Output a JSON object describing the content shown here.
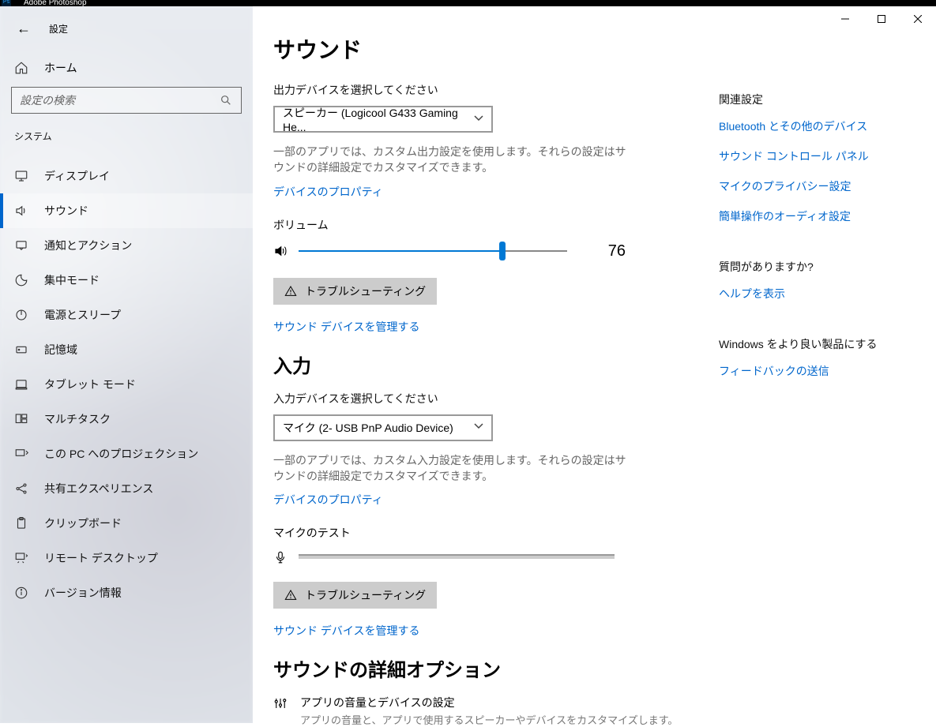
{
  "taskbar_app": "Adobe Photoshop",
  "header": {
    "back_icon": "←",
    "title": "設定"
  },
  "home_label": "ホーム",
  "search": {
    "placeholder": "設定の検索"
  },
  "category": "システム",
  "nav": [
    {
      "id": "display",
      "label": "ディスプレイ"
    },
    {
      "id": "sound",
      "label": "サウンド"
    },
    {
      "id": "notifications",
      "label": "通知とアクション"
    },
    {
      "id": "focus",
      "label": "集中モード"
    },
    {
      "id": "power",
      "label": "電源とスリープ"
    },
    {
      "id": "storage",
      "label": "記憶域"
    },
    {
      "id": "tablet",
      "label": "タブレット モード"
    },
    {
      "id": "multitask",
      "label": "マルチタスク"
    },
    {
      "id": "projection",
      "label": "この PC へのプロジェクション"
    },
    {
      "id": "shared",
      "label": "共有エクスペリエンス"
    },
    {
      "id": "clipboard",
      "label": "クリップボード"
    },
    {
      "id": "remote",
      "label": "リモート デスクトップ"
    },
    {
      "id": "about",
      "label": "バージョン情報"
    }
  ],
  "main": {
    "title": "サウンド",
    "output": {
      "label": "出力デバイスを選択してください",
      "selected": "スピーカー (Logicool G433 Gaming He...",
      "desc": "一部のアプリでは、カスタム出力設定を使用します。それらの設定はサウンドの詳細設定でカスタマイズできます。",
      "properties_link": "デバイスのプロパティ",
      "volume_label": "ボリューム",
      "volume_value": "76",
      "troubleshoot": "トラブルシューティング",
      "manage_link": "サウンド デバイスを管理する"
    },
    "input": {
      "title": "入力",
      "label": "入力デバイスを選択してください",
      "selected": "マイク (2- USB PnP Audio Device)",
      "desc": "一部のアプリでは、カスタム入力設定を使用します。それらの設定はサウンドの詳細設定でカスタマイズできます。",
      "properties_link": "デバイスのプロパティ",
      "test_label": "マイクのテスト",
      "troubleshoot": "トラブルシューティング",
      "manage_link": "サウンド デバイスを管理する"
    },
    "advanced": {
      "title": "サウンドの詳細オプション",
      "row_title": "アプリの音量とデバイスの設定",
      "row_desc": "アプリの音量と、アプリで使用するスピーカーやデバイスをカスタマイズします。"
    }
  },
  "right": {
    "related_heading": "関連設定",
    "related_links": [
      "Bluetooth とその他のデバイス",
      "サウンド コントロール パネル",
      "マイクのプライバシー設定",
      "簡単操作のオーディオ設定"
    ],
    "help_heading": "質問がありますか?",
    "help_link": "ヘルプを表示",
    "feedback_heading": "Windows をより良い製品にする",
    "feedback_link": "フィードバックの送信"
  }
}
